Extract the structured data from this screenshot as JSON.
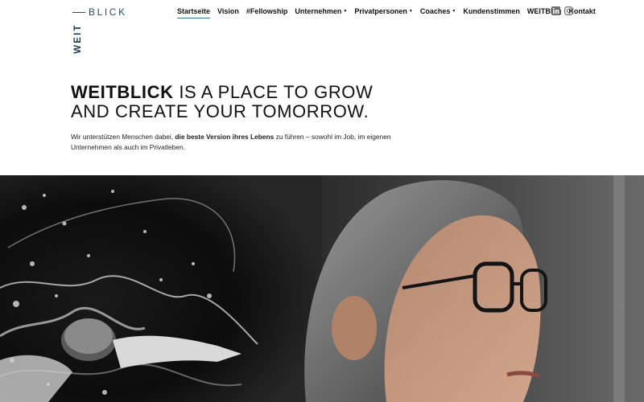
{
  "logo": {
    "top": "BLICK",
    "side": "WEIT"
  },
  "nav": [
    {
      "label": "Startseite",
      "dropdown": false,
      "active": true
    },
    {
      "label": "Vision",
      "dropdown": false,
      "active": false
    },
    {
      "label": "#Fellowship",
      "dropdown": false,
      "active": false
    },
    {
      "label": "Unternehmen",
      "dropdown": true,
      "active": false
    },
    {
      "label": "Privatpersonen",
      "dropdown": true,
      "active": false
    },
    {
      "label": "Coaches",
      "dropdown": true,
      "active": false
    },
    {
      "label": "Kundenstimmen",
      "dropdown": false,
      "active": false
    },
    {
      "label": "WEITBlog",
      "dropdown": false,
      "active": false
    },
    {
      "label": "Kontakt",
      "dropdown": false,
      "active": false
    }
  ],
  "social": [
    "linkedin-icon",
    "instagram-icon"
  ],
  "hero": {
    "title_brand": "WEITBLICK",
    "title_rest_1": " IS A PLACE TO GROW",
    "title_line2": "AND CREATE YOUR TOMORROW.",
    "text_before": "Wir unterstützen Menschen dabei, ",
    "text_bold": "die beste Version ihres Lebens",
    "text_after": " zu führen – sowohl im Job, im eigenen Unternehmen als auch im Privatleben."
  },
  "colors": {
    "accent": "#3d7d8c",
    "brand": "#2e4b63"
  }
}
